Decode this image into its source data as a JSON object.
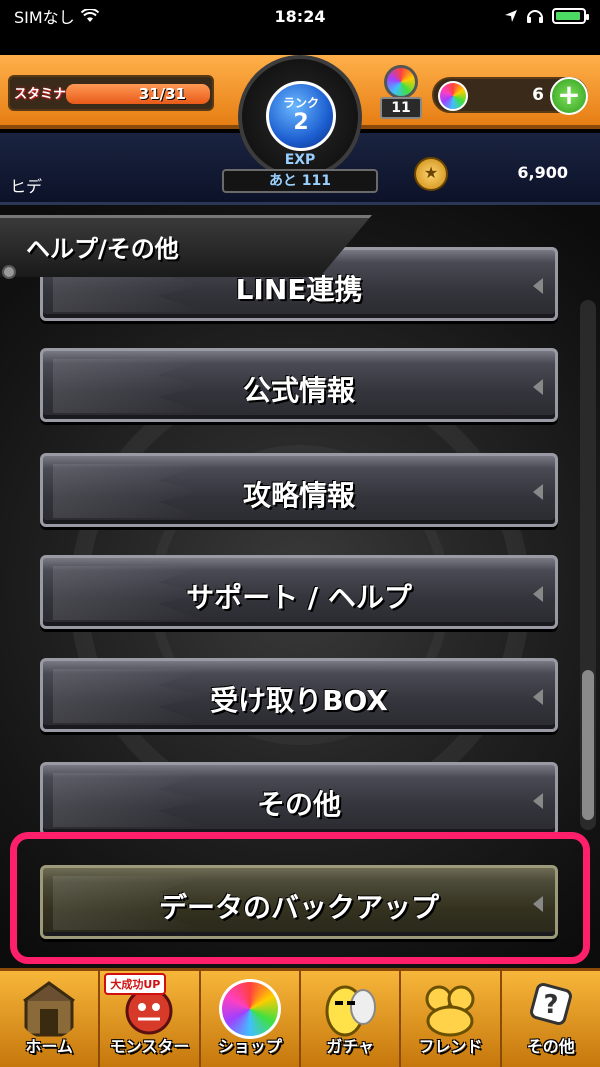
{
  "status_bar": {
    "carrier": "SIMなし",
    "time": "18:24"
  },
  "header": {
    "stamina_label": "スタミナ",
    "stamina_value": "31/31",
    "stamina_fraction": 1.0,
    "rank_label": "ランク",
    "rank_value": "2",
    "lucky_count": "11",
    "orb_count": "6",
    "plus_label": "+",
    "exp_label": "EXP",
    "exp_remaining": "あと 111",
    "player_name": "ヒデ",
    "coins": "6,900"
  },
  "section": {
    "title": "ヘルプ/その他"
  },
  "menu": {
    "items": [
      {
        "label": "LINE連携"
      },
      {
        "label": "公式情報"
      },
      {
        "label": "攻略情報"
      },
      {
        "label": "サポート / ヘルプ"
      },
      {
        "label": "受け取りBOX"
      },
      {
        "label": "その他"
      },
      {
        "label": "データのバックアップ"
      }
    ]
  },
  "bottom_nav": {
    "items": [
      {
        "label": "ホーム",
        "icon": "home-icon"
      },
      {
        "label": "モンスター",
        "icon": "monster-icon",
        "badge": "大成功UP"
      },
      {
        "label": "ショップ",
        "icon": "shop-orb-icon"
      },
      {
        "label": "ガチャ",
        "icon": "gacha-egg-icon"
      },
      {
        "label": "フレンド",
        "icon": "friend-icon"
      },
      {
        "label": "その他",
        "icon": "other-icon"
      }
    ]
  },
  "colors": {
    "highlight": "#ff1f6a",
    "header": "#f0952a",
    "rank": "#1d5fd1"
  }
}
